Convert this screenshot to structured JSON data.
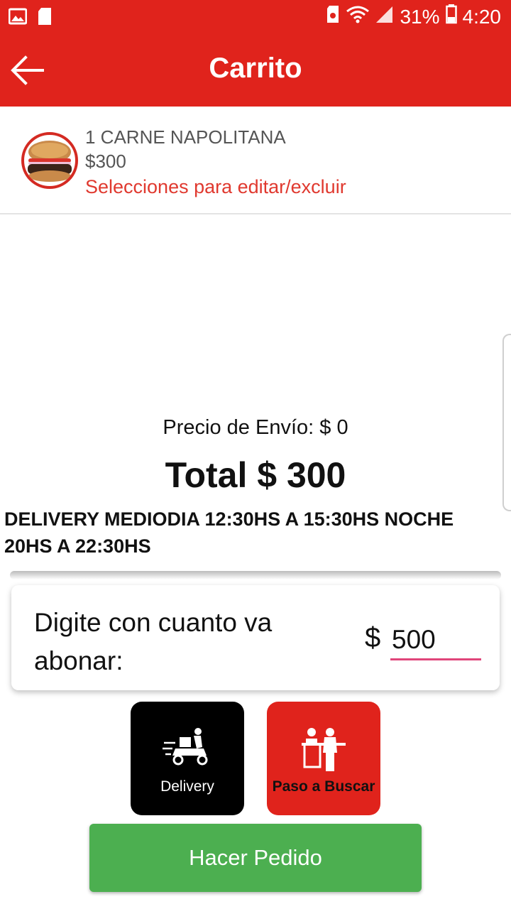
{
  "status_bar": {
    "battery": "31%",
    "time": "4:20",
    "icons": [
      "image-icon",
      "sd-card-icon",
      "sim-icon",
      "wifi-icon",
      "signal-icon",
      "battery-icon"
    ]
  },
  "app_bar": {
    "title": "Carrito",
    "back_icon": "arrow-left-icon",
    "color": "#e0231c"
  },
  "cart_item": {
    "name": "1 CARNE NAPOLITANA",
    "price": "$300",
    "edit_hint": "Selecciones para editar/excluir"
  },
  "summary": {
    "shipping": "Precio de Envío: $ 0",
    "total": "Total $ 300",
    "hours": "DELIVERY MEDIODIA 12:30HS A 15:30HS NOCHE 20HS A 22:30HS"
  },
  "payment": {
    "label": "Digite con cuanto va abonar:",
    "currency": "$",
    "value": "500"
  },
  "options": {
    "delivery_label": "Delivery",
    "pickup_label": "Paso a Buscar"
  },
  "order_button": {
    "label": "Hacer Pedido",
    "color": "#4caf50"
  }
}
